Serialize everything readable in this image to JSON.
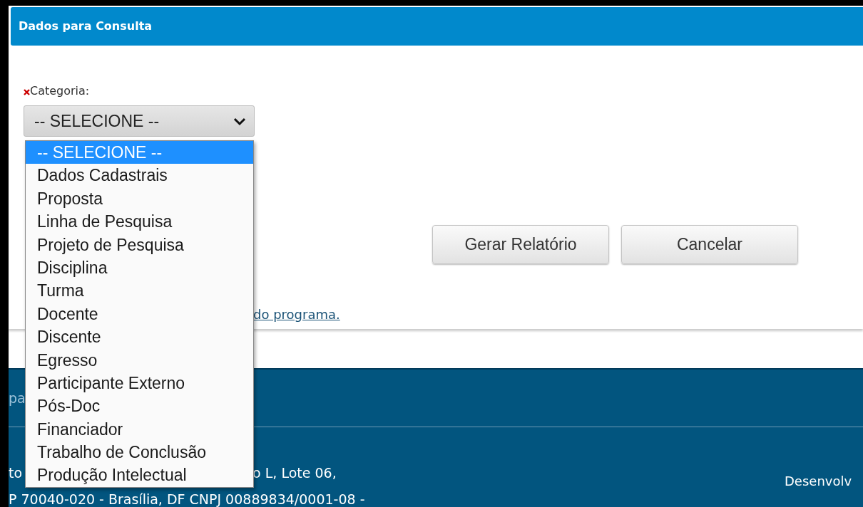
{
  "panel": {
    "title": "Dados para Consulta"
  },
  "category_field": {
    "label": "Categoria:",
    "required": true,
    "value": "-- SELECIONE --",
    "expanded": true,
    "options": [
      {
        "label": "-- SELECIONE --",
        "selected": true
      },
      {
        "label": "Dados Cadastrais",
        "selected": false
      },
      {
        "label": "Proposta",
        "selected": false
      },
      {
        "label": "Linha de Pesquisa",
        "selected": false
      },
      {
        "label": "Projeto de Pesquisa",
        "selected": false
      },
      {
        "label": "Disciplina",
        "selected": false
      },
      {
        "label": "Turma",
        "selected": false
      },
      {
        "label": "Docente",
        "selected": false
      },
      {
        "label": "Discente",
        "selected": false
      },
      {
        "label": "Egresso",
        "selected": false
      },
      {
        "label": "Participante Externo",
        "selected": false
      },
      {
        "label": "Pós-Doc",
        "selected": false
      },
      {
        "label": "Financiador",
        "selected": false
      },
      {
        "label": "Trabalho de Conclusão",
        "selected": false
      },
      {
        "label": "Produção Intelectual",
        "selected": false
      }
    ]
  },
  "buttons": [
    "Gerar Relatório",
    "Cancelar"
  ],
  "link": "do programa.",
  "footer": {
    "heading_fragment": "pa",
    "address_line_1_start": "to",
    "address_line_1_end": "o L, Lote 06,",
    "address_line_2": "P 70040-020 - Brasília, DF CNPJ 00889834/0001-08 -",
    "developer": "Desenvolv"
  }
}
